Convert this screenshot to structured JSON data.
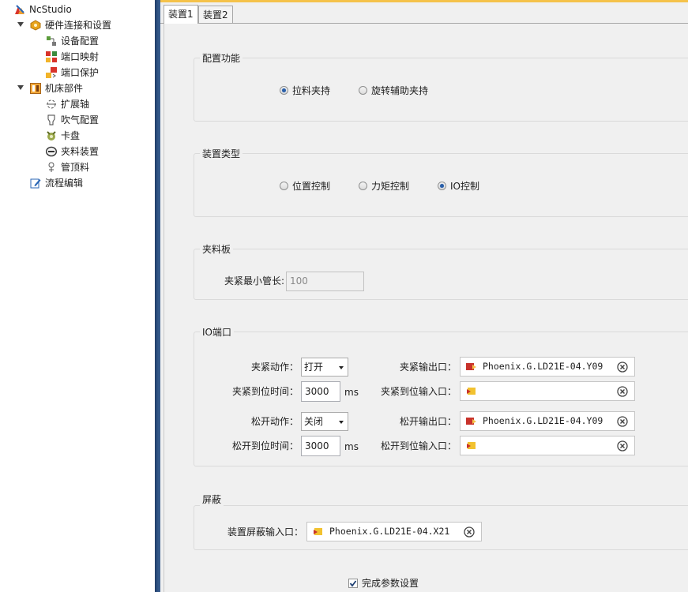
{
  "tree": {
    "root": "NcStudio",
    "hardware": "硬件连接和设置",
    "device_config": "设备配置",
    "port_map": "端口映射",
    "port_protect": "端口保护",
    "machine_parts": "机床部件",
    "ext_axis": "扩展轴",
    "blow_config": "吹气配置",
    "chuck": "卡盘",
    "clamp_device": "夹料装置",
    "pipe_top": "管顶料",
    "flow_edit": "流程编辑"
  },
  "tabs": [
    "装置1",
    "装置2"
  ],
  "active_tab": "装置1",
  "config_function": {
    "title": "配置功能",
    "options": [
      "拉料夹持",
      "旋转辅助夹持"
    ],
    "selected": "拉料夹持"
  },
  "device_type": {
    "title": "装置类型",
    "options": [
      "位置控制",
      "力矩控制",
      "IO控制"
    ],
    "selected": "IO控制"
  },
  "clamp_plate": {
    "title": "夹料板",
    "min_len_label": "夹紧最小管长:",
    "min_len_value": "100"
  },
  "io_port": {
    "title": "IO端口",
    "clamp_action_label": "夹紧动作：",
    "clamp_action_value": "打开",
    "clamp_output_label": "夹紧输出口：",
    "clamp_output_value": "Phoenix.G.LD21E-04.Y09",
    "clamp_time_label": "夹紧到位时间：",
    "clamp_time_value": "3000",
    "clamp_time_unit": "ms",
    "clamp_input_label": "夹紧到位输入口：",
    "clamp_input_value": "",
    "release_action_label": "松开动作：",
    "release_action_value": "关闭",
    "release_output_label": "松开输出口：",
    "release_output_value": "Phoenix.G.LD21E-04.Y09",
    "release_time_label": "松开到位时间：",
    "release_time_value": "3000",
    "release_time_unit": "ms",
    "release_input_label": "松开到位输入口：",
    "release_input_value": ""
  },
  "shield": {
    "title": "屏蔽",
    "input_label": "装置屏蔽输入口：",
    "input_value": "Phoenix.G.LD21E-04.X21"
  },
  "finish": {
    "label": "完成参数设置",
    "checked": true
  },
  "colors": {
    "splitter": "#2c4f80",
    "top_accent": "#f5c24a",
    "panel_bg": "#f0f0f0",
    "radio_selected": "#2a5fa8"
  }
}
